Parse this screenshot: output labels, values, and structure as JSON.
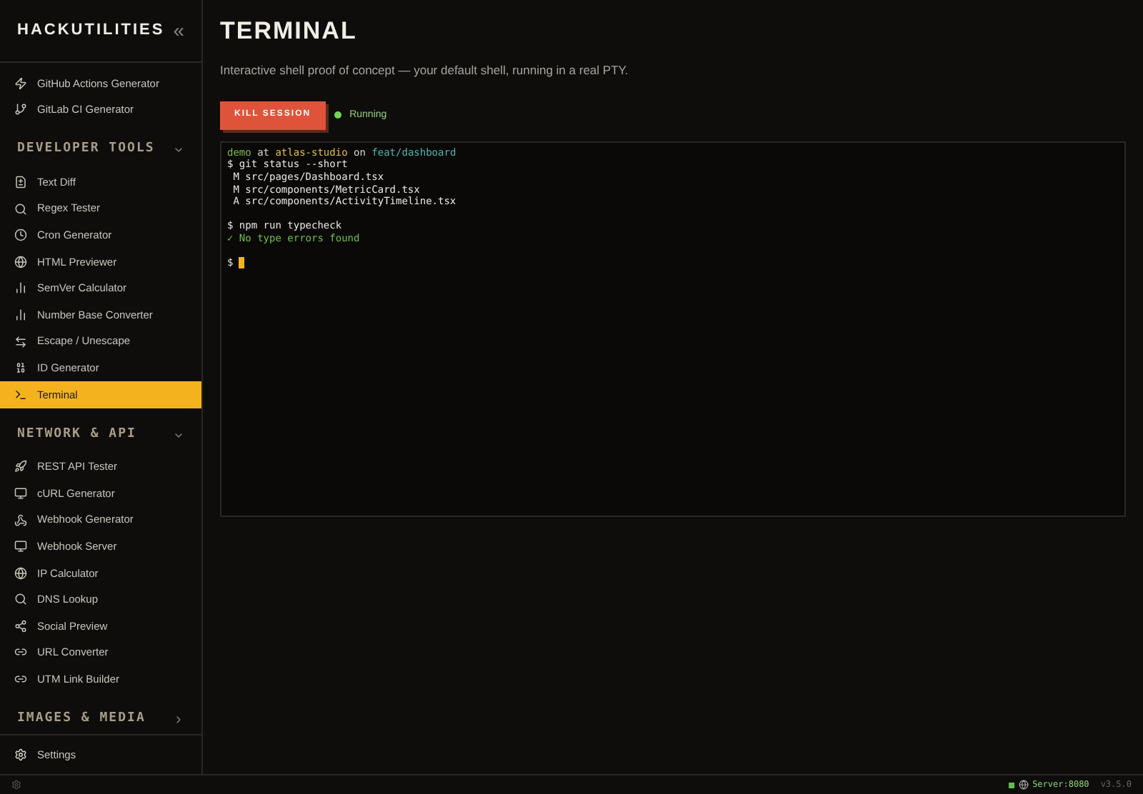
{
  "sidebar": {
    "brand": "HACKUTILITIES",
    "collapse": "«",
    "groups": [
      {
        "items": [
          {
            "label": "GitHub Actions Generator",
            "selected": false
          },
          {
            "label": "GitLab CI Generator",
            "selected": false
          }
        ]
      },
      {
        "title": "DEVELOPER TOOLS",
        "expanded": true,
        "items": [
          {
            "label": "Text Diff",
            "selected": false
          },
          {
            "label": "Regex Tester",
            "selected": false
          },
          {
            "label": "Cron Generator",
            "selected": false
          },
          {
            "label": "HTML Previewer",
            "selected": false
          },
          {
            "label": "SemVer Calculator",
            "selected": false
          },
          {
            "label": "Number Base Converter",
            "selected": false
          },
          {
            "label": "Escape / Unescape",
            "selected": false
          },
          {
            "label": "ID Generator",
            "selected": false
          },
          {
            "label": "Terminal",
            "selected": true
          }
        ]
      },
      {
        "title": "NETWORK & API",
        "expanded": true,
        "items": [
          {
            "label": "REST API Tester",
            "selected": false
          },
          {
            "label": "cURL Generator",
            "selected": false
          },
          {
            "label": "Webhook Generator",
            "selected": false
          },
          {
            "label": "Webhook Server",
            "selected": false
          },
          {
            "label": "IP Calculator",
            "selected": false
          },
          {
            "label": "DNS Lookup",
            "selected": false
          },
          {
            "label": "Social Preview",
            "selected": false
          },
          {
            "label": "URL Converter",
            "selected": false
          },
          {
            "label": "UTM Link Builder",
            "selected": false
          }
        ]
      },
      {
        "title": "IMAGES & MEDIA",
        "expanded": false
      }
    ],
    "settings": "Settings"
  },
  "page": {
    "title": "TERMINAL",
    "description": "Interactive shell proof of concept — your default shell, running in a real PTY.",
    "kill_button": "KILL SESSION",
    "status": "Running",
    "running": true
  },
  "terminal": {
    "lines": [
      {
        "kind": "text",
        "segments": [
          {
            "text": "demo",
            "color": "#7fb84a"
          },
          {
            "text": " at ",
            "color": "#d8d8d0"
          },
          {
            "text": "atlas-studio",
            "color": "#e0c040"
          },
          {
            "text": " on ",
            "color": "#d8d8d0"
          },
          {
            "text": "feat/dashboard",
            "color": "#4fb8b0"
          }
        ]
      },
      {
        "kind": "text",
        "segments": [
          {
            "text": "$ git status --short",
            "color": "#e8e8e0"
          }
        ]
      },
      {
        "kind": "text",
        "segments": [
          {
            "text": " M src/pages/Dashboard.tsx",
            "color": "#e8e8e0"
          }
        ]
      },
      {
        "kind": "text",
        "segments": [
          {
            "text": " M src/components/MetricCard.tsx",
            "color": "#e8e8e0"
          }
        ]
      },
      {
        "kind": "text",
        "segments": [
          {
            "text": " A src/components/ActivityTimeline.tsx",
            "color": "#e8e8e0"
          }
        ]
      },
      {
        "kind": "blank"
      },
      {
        "kind": "text",
        "segments": [
          {
            "text": "$ npm run typecheck",
            "color": "#e8e8e0"
          }
        ]
      },
      {
        "kind": "text",
        "segments": [
          {
            "text": "✓ No type errors found",
            "color": "#6fbf4a"
          }
        ]
      },
      {
        "kind": "blank"
      },
      {
        "kind": "text",
        "segments": [
          {
            "text": "$",
            "color": "#e8e8e0"
          }
        ]
      }
    ],
    "cursor": true
  },
  "status_bar": {
    "server": "Server:8080",
    "server_up": true,
    "version": "v3.5.0"
  }
}
